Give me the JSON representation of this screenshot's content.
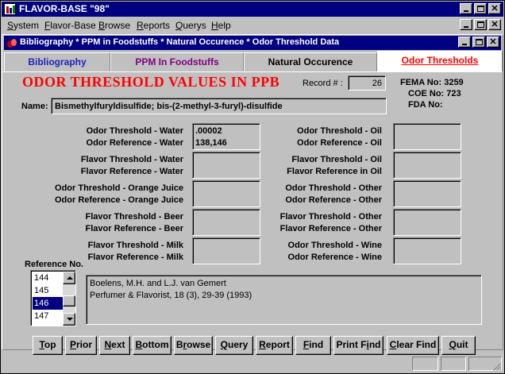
{
  "app": {
    "title": "FLAVOR-BASE \"98\"",
    "menu": [
      {
        "label": "System",
        "u": "S",
        "rest": "ystem"
      },
      {
        "label": "Flavor-Base",
        "u": "F",
        "rest": "lavor-Base"
      },
      {
        "label": "Browse",
        "u": "B",
        "rest": "rowse"
      },
      {
        "label": "Reports",
        "u": "R",
        "rest": "eports"
      },
      {
        "label": "Querys",
        "u": "Q",
        "rest": "uerys"
      },
      {
        "label": "Help",
        "u": "H",
        "rest": "elp"
      }
    ]
  },
  "child": {
    "title": "Bibliography * PPM in Foodstuffs * Natural Occurence * Odor Threshold Data"
  },
  "tabs": [
    {
      "label": "Bibliography",
      "color": "#2020c0"
    },
    {
      "label": "PPM In Foodstuffs",
      "color": "#800080"
    },
    {
      "label": "Natural Occurence",
      "color": "#000000"
    },
    {
      "label": "Odor Thresholds",
      "color": "#ff0000"
    }
  ],
  "form": {
    "heading": "ODOR THRESHOLD VALUES IN PPB",
    "record_label": "Record # :",
    "record_value": "26",
    "fema_label": "FEMA No:",
    "fema_value": "3259",
    "coe_label": "COE No:",
    "coe_value": "723",
    "fda_label": "FDA No:",
    "fda_value": "",
    "name_label": "Name:",
    "name_value": "Bismethylfuryldisulfide; bis-(2-methyl-3-furyl)-disulfide"
  },
  "left_pairs": [
    {
      "l1": "Odor Threshold - Water",
      "l2": "Odor Reference - Water",
      "v1": ".00002",
      "v2": "138,146"
    },
    {
      "l1": "Flavor Threshold - Water",
      "l2": "Flavor Reference - Water",
      "v1": "",
      "v2": ""
    },
    {
      "l1": "Odor Threshold - Orange Juice",
      "l2": "Odor Reference - Orange Juice",
      "v1": "",
      "v2": ""
    },
    {
      "l1": "Flavor Threshold - Beer",
      "l2": "Flavor Reference - Beer",
      "v1": "",
      "v2": ""
    },
    {
      "l1": "Flavor Threshold - Milk",
      "l2": "Flavor Reference - Milk",
      "v1": "",
      "v2": ""
    }
  ],
  "right_pairs": [
    {
      "l1": "Odor Threshold - Oil",
      "l2": "Odor Reference - Oil",
      "v1": "",
      "v2": ""
    },
    {
      "l1": "Flavor Threshold - Oil",
      "l2": "Flavor Reference in Oil",
      "v1": "",
      "v2": ""
    },
    {
      "l1": "Odor Threshold - Other",
      "l2": "Odor Reference - Other",
      "v1": "",
      "v2": ""
    },
    {
      "l1": "Flavor Threshold - Other",
      "l2": "Flavor Reference - Other",
      "v1": "",
      "v2": ""
    },
    {
      "l1": "Odor Threshold - Wine",
      "l2": "Odor Reference - Wine",
      "v1": "",
      "v2": ""
    }
  ],
  "reference": {
    "label": "Reference No.",
    "items": [
      "144",
      "145",
      "146",
      "147"
    ],
    "selected_index": 2,
    "text_line1": "Boelens, M.H. and L.J. van Gemert",
    "text_line2": "Perfumer & Flavorist, 18 (3), 29-39 (1993)"
  },
  "buttons": [
    {
      "label": "Top",
      "u": "T",
      "rest": "op"
    },
    {
      "label": "Prior",
      "u": "P",
      "rest": "rior"
    },
    {
      "label": "Next",
      "u": "N",
      "rest": "ext"
    },
    {
      "label": "Bottom",
      "u": "B",
      "rest": "ottom"
    },
    {
      "label": "Browse",
      "pre": "B",
      "u": "r",
      "rest": "owse"
    },
    {
      "label": "Query",
      "u": "Q",
      "rest": "uery"
    },
    {
      "label": "Report",
      "u": "R",
      "rest": "eport"
    },
    {
      "label": "Find",
      "u": "F",
      "rest": "ind"
    },
    {
      "label": "Print Find",
      "pre": "Print F",
      "u": "i",
      "rest": "nd"
    },
    {
      "label": "Clear Find",
      "u": "C",
      "rest": "lear Find"
    },
    {
      "label": "Quit",
      "u": "Q",
      "rest": "uit"
    }
  ],
  "icons": {
    "app": "flavor-base-app-icon",
    "child": "document-icon",
    "minimize": "minimize-icon",
    "maximize": "maximize-icon",
    "close": "close-icon"
  }
}
